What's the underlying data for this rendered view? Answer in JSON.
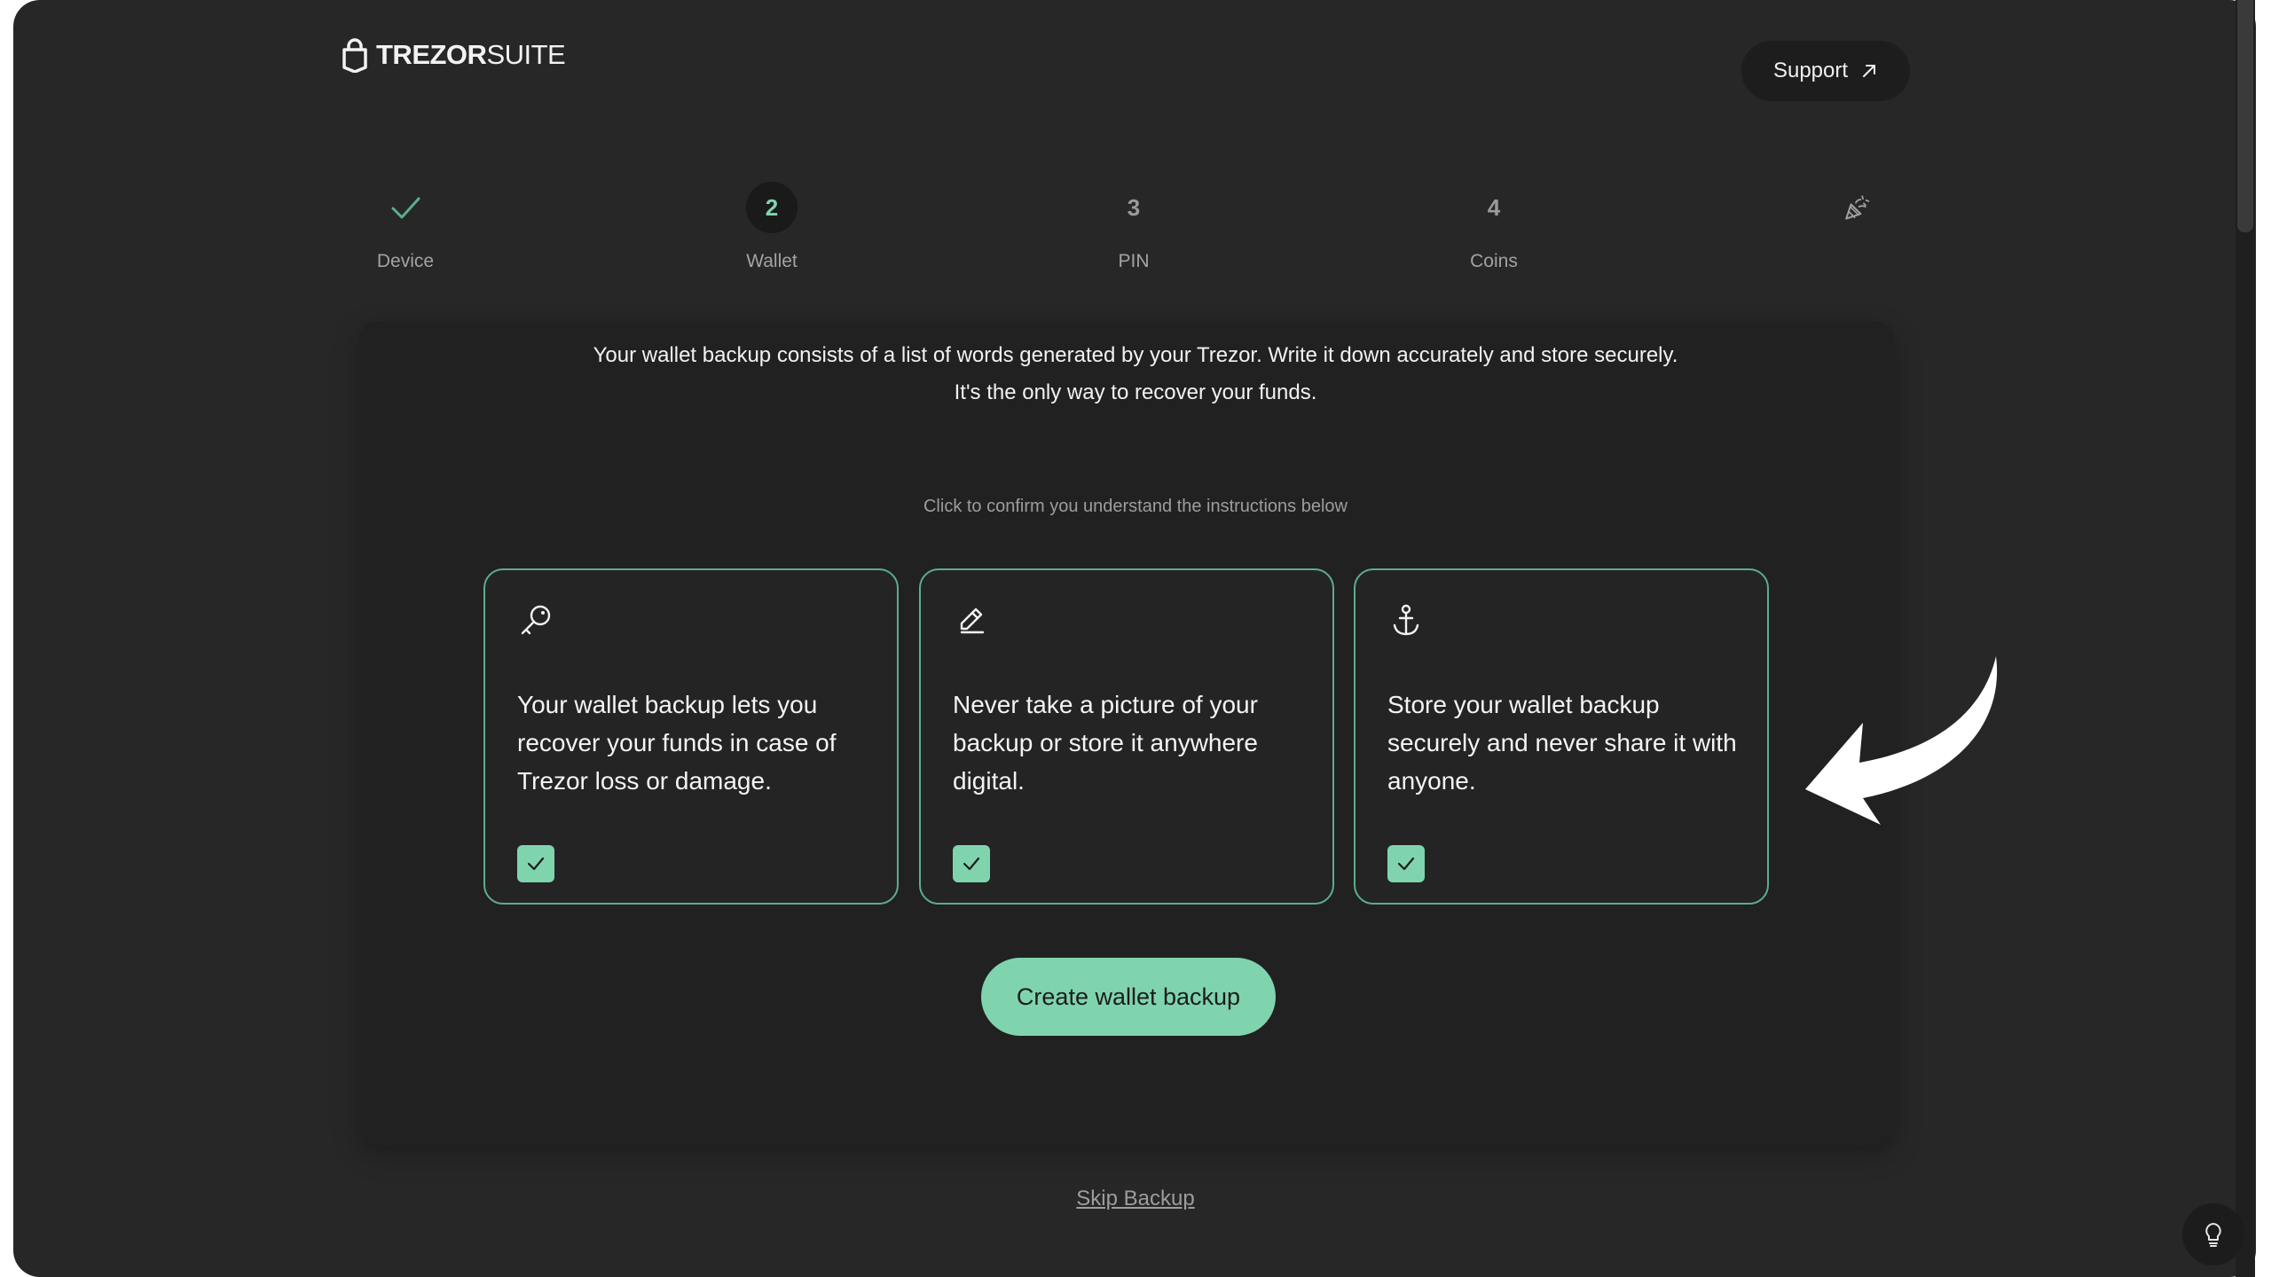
{
  "header": {
    "brand_bold": "TREZOR",
    "brand_light": "SUITE",
    "support_label": "Support"
  },
  "steps": [
    {
      "label": "Device",
      "state": "done"
    },
    {
      "num": "2",
      "label": "Wallet",
      "state": "active"
    },
    {
      "num": "3",
      "label": "PIN",
      "state": "pending"
    },
    {
      "num": "4",
      "label": "Coins",
      "state": "pending"
    },
    {
      "label": "",
      "state": "final",
      "icon": "party-popper-icon"
    }
  ],
  "intro": {
    "line1": "Your wallet backup consists of a list of words generated by your Trezor. Write it down accurately and store securely.",
    "line2": "It's the only way to recover your funds."
  },
  "hint": "Click to confirm you understand the instructions below",
  "tiles": [
    {
      "icon": "key-icon",
      "text": "Your wallet backup lets you recover your funds in case of Trezor loss or damage.",
      "checked": true
    },
    {
      "icon": "pencil-icon",
      "text": "Never take a picture of your backup or store it anywhere digital.",
      "checked": true
    },
    {
      "icon": "anchor-icon",
      "text": "Store your wallet backup securely and never share it with anyone.",
      "checked": true
    }
  ],
  "create_button_label": "Create wallet backup",
  "skip_label": "Skip Backup",
  "colors": {
    "accent": "#7fd4ae",
    "tile_border": "#5cae8a",
    "background": "#272727",
    "card": "#212121"
  }
}
